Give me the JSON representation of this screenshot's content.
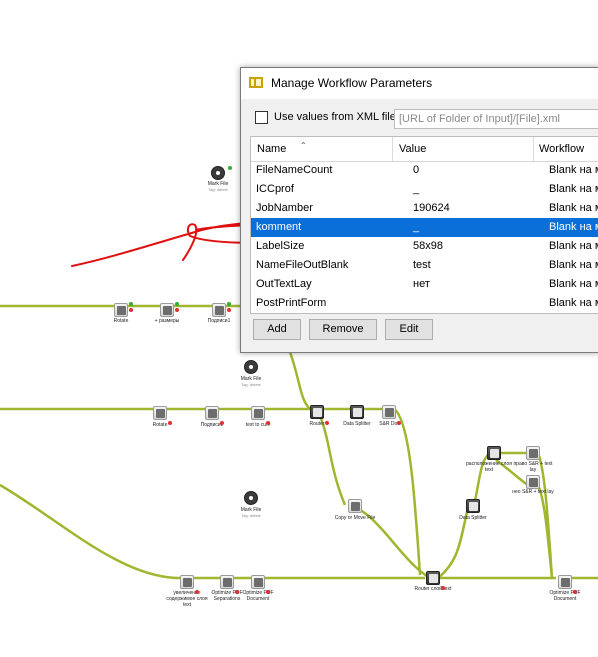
{
  "dialog": {
    "title": "Manage Workflow Parameters",
    "use_xml_label": "Use values from XML file",
    "xml_placeholder": "[URL of Folder of Input]/[File].xml",
    "columns": [
      "Name",
      "Value",
      "Workflow"
    ],
    "rows": [
      {
        "name": "FileNameCount",
        "value": "0",
        "workflow": "Blank на м"
      },
      {
        "name": "ICCprof",
        "value": "_",
        "workflow": "Blank на м"
      },
      {
        "name": "JobNamber",
        "value": "190624",
        "workflow": "Blank на м"
      },
      {
        "name": "komment",
        "value": "_",
        "workflow": "Blank на м",
        "selected": true
      },
      {
        "name": "LabelSize",
        "value": "58x98",
        "workflow": "Blank на м"
      },
      {
        "name": "NameFileOutBlank",
        "value": "test",
        "workflow": "Blank на м"
      },
      {
        "name": "OutTextLay",
        "value": "нет",
        "workflow": "Blank на м"
      },
      {
        "name": "PostPrintForm",
        "value": "",
        "workflow": "Blank на м"
      }
    ],
    "buttons": {
      "add": "Add",
      "remove": "Remove",
      "edit": "Edit"
    }
  },
  "workflow": {
    "colors": {
      "connector": "#9fb62f",
      "ok_port": "#30b030",
      "error_port": "#e03030",
      "annotation": "#e01010"
    },
    "nodes": {
      "mark_file_1": {
        "label": "Mark File",
        "sub": "Tag: delete"
      },
      "rotate_1": {
        "label": "Rotate"
      },
      "razmery": {
        "label": "+ размеры"
      },
      "podpisi_1": {
        "label": "Подписи1"
      },
      "mark_file_2": {
        "label": "Mark File",
        "sub": "Tag: delete"
      },
      "rotate_2": {
        "label": "Rotate"
      },
      "podpisi_2": {
        "label": "Подписи2"
      },
      "text_to_curv": {
        "label": "text to curv"
      },
      "router_1": {
        "label": "Router"
      },
      "data_splitter_1": {
        "label": "Data Splitter"
      },
      "sr_dot": {
        "label": "S&R Dot"
      },
      "mark_file_3": {
        "label": "Mark File",
        "sub": "Tag: delete"
      },
      "copy_move": {
        "label": "Copy or Move File"
      },
      "rasp_text": {
        "label": "расположение слоя text"
      },
      "pravo_sr": {
        "label": "право S&R + text lay"
      },
      "neo_sr": {
        "label": "нео S&R + text lay"
      },
      "data_splitter_2": {
        "label": "Data Splitter"
      },
      "delete_layer": {
        "label": "увеличение содержимое слоя text"
      },
      "optimize_sep": {
        "label": "Optimize PDF Separations"
      },
      "optimize_doc_1": {
        "label": "Optimize PDF Document"
      },
      "router_text": {
        "label": "Router слой text"
      },
      "optimize_doc_2": {
        "label": "Optimize PDF Document"
      }
    }
  }
}
